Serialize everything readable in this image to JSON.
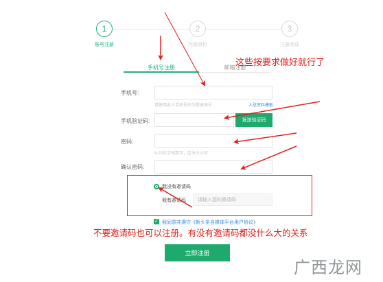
{
  "steps": [
    {
      "number": "1",
      "label": "账号注册",
      "active": true
    },
    {
      "number": "2",
      "label": "完善资料",
      "active": false
    },
    {
      "number": "3",
      "label": "注册完成",
      "active": false
    }
  ],
  "tabs": [
    {
      "label": "手机号注册",
      "active": true
    },
    {
      "label": "邮箱注册",
      "active": false
    }
  ],
  "form": {
    "phone_label": "手机号:",
    "phone_hint": "请使用本人手机号作为登录账号",
    "phone_link": "入驻资料模板",
    "code_label": "手机验证码:",
    "send_code_button": "发送验证码",
    "password_label": "密码:",
    "password_hint": "6-20位字母数字，区分大小写",
    "confirm_label": "确认密码:",
    "no_invite_label": "我没有邀请码",
    "has_invite_label": "我有邀请码",
    "invite_placeholder": "请输入您的邀请码",
    "agree_text": "我同意并遵守《新头条自媒体平台用户协议》",
    "agree_checked": true,
    "invite_choice": "no_invite",
    "submit_button": "立即注册"
  },
  "annotations": {
    "top_note": "这些按要求做好就行了",
    "bottom_note": "不要邀请码也可以注册。有没有邀请码都没什么大的关系"
  },
  "watermark": "广西龙网",
  "colors": {
    "brand_green": "#1faa6d",
    "annotation_red": "#e0201b",
    "link_blue": "#3b8ce0"
  }
}
